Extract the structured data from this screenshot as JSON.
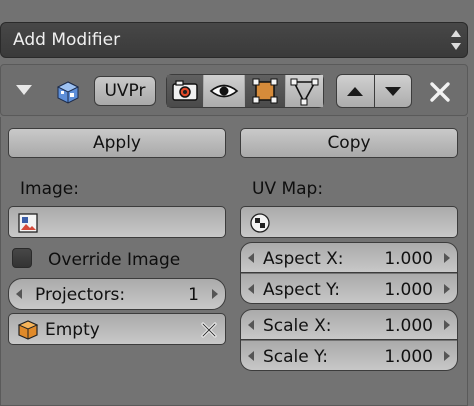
{
  "add_modifier": {
    "label": "Add Modifier"
  },
  "modifier": {
    "name": "UVPr",
    "apply_label": "Apply",
    "copy_label": "Copy"
  },
  "left": {
    "image_label": "Image:",
    "image_value": "",
    "override_label": "Override Image",
    "override_checked": false,
    "projectors_label": "Projectors:",
    "projectors_value": "1",
    "object_value": "Empty"
  },
  "right": {
    "uvmap_label": "UV Map:",
    "uvmap_value": "",
    "aspect_x_label": "Aspect X:",
    "aspect_x_value": "1.000",
    "aspect_y_label": "Aspect Y:",
    "aspect_y_value": "1.000",
    "scale_x_label": "Scale X:",
    "scale_x_value": "1.000",
    "scale_y_label": "Scale Y:",
    "scale_y_value": "1.000"
  },
  "icons": {
    "collapse": "triangle-down-icon",
    "modifier_type": "uv-project-icon",
    "render": "camera-icon",
    "viewport": "eye-icon",
    "editmode": "editmode-icon",
    "cage": "cage-vertex-icon",
    "move_up": "arrow-up-icon",
    "move_down": "arrow-down-icon",
    "remove": "close-icon",
    "image": "image-icon",
    "uvmap": "uv-map-icon",
    "object": "object-cube-icon",
    "clear": "clear-icon"
  },
  "colors": {
    "background": "#727272",
    "button": "#b9b9b9",
    "dark_bar": "#404040"
  }
}
